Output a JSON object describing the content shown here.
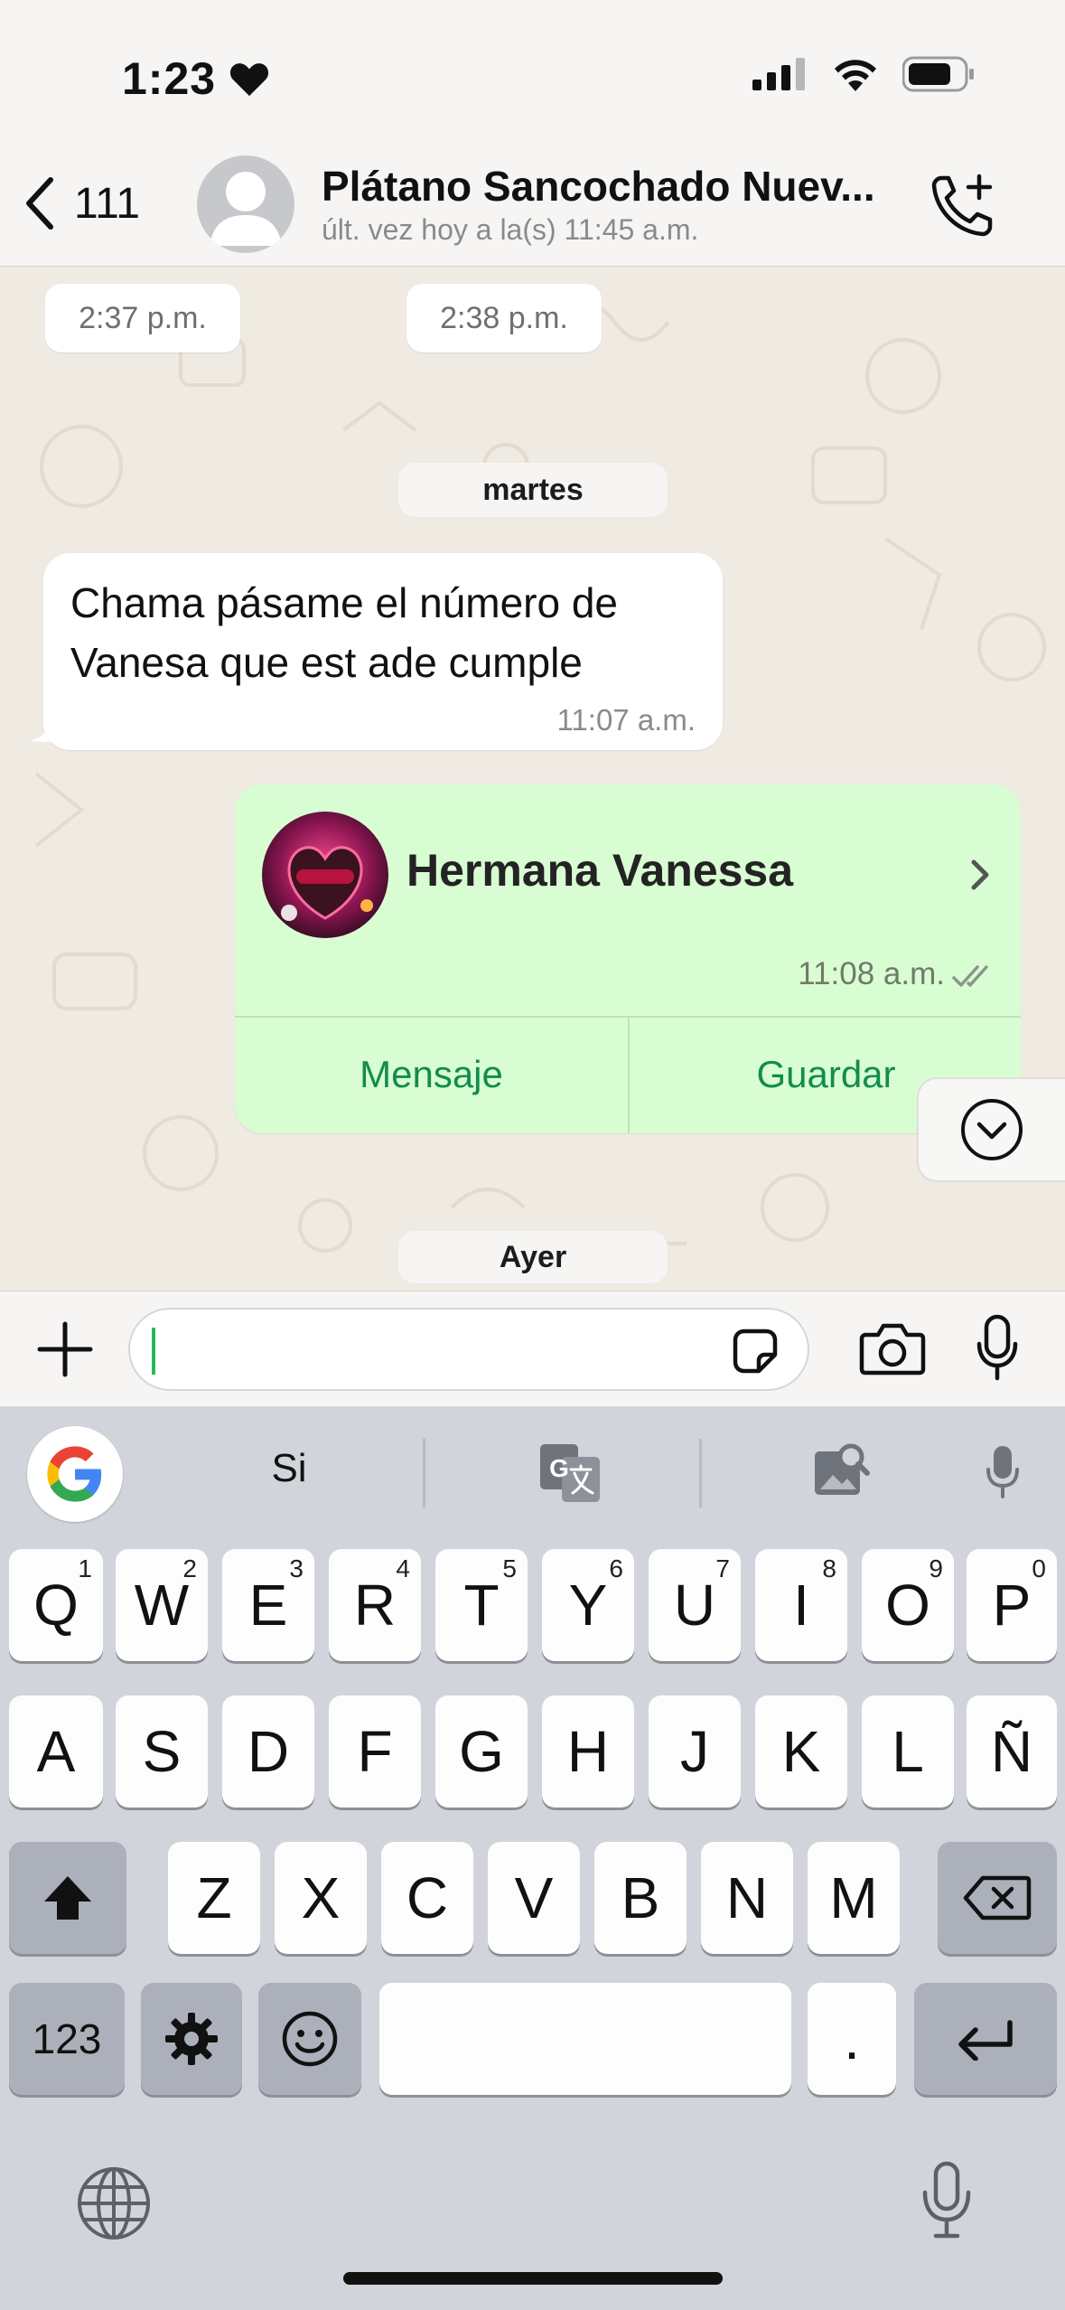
{
  "status_bar": {
    "time": "1:23"
  },
  "header": {
    "back_count": "111",
    "contact_name": "Plátano Sancochado Nuev...",
    "contact_status": "últ. vez hoy a la(s) 11:45 a.m."
  },
  "chat": {
    "time_chips": [
      "2:37 p.m.",
      "2:38 p.m."
    ],
    "date_separator_1": "martes",
    "incoming": {
      "text_line1": "Chama pásame el número de",
      "text_line2": "Vanesa que est ade cumple",
      "time": "11:07 a.m."
    },
    "outgoing_contact": {
      "name": "Hermana Vanessa",
      "time": "11:08 a.m.",
      "action_message": "Mensaje",
      "action_save": "Guardar"
    },
    "date_separator_2": "Ayer"
  },
  "composer": {
    "value": ""
  },
  "keyboard": {
    "suggestion": "Si",
    "row1": [
      {
        "k": "Q",
        "h": "1"
      },
      {
        "k": "W",
        "h": "2"
      },
      {
        "k": "E",
        "h": "3"
      },
      {
        "k": "R",
        "h": "4"
      },
      {
        "k": "T",
        "h": "5"
      },
      {
        "k": "Y",
        "h": "6"
      },
      {
        "k": "U",
        "h": "7"
      },
      {
        "k": "I",
        "h": "8"
      },
      {
        "k": "O",
        "h": "9"
      },
      {
        "k": "P",
        "h": "0"
      }
    ],
    "row2": [
      "A",
      "S",
      "D",
      "F",
      "G",
      "H",
      "J",
      "K",
      "L",
      "Ñ"
    ],
    "row3": [
      "Z",
      "X",
      "C",
      "V",
      "B",
      "N",
      "M"
    ],
    "numbers_key": "123",
    "period_key": "."
  },
  "colors": {
    "chat_bg": "#efeae2",
    "outgoing_bubble": "#d9fdd3",
    "accent_green": "#128c4e",
    "keyboard_bg": "#d1d4da"
  }
}
